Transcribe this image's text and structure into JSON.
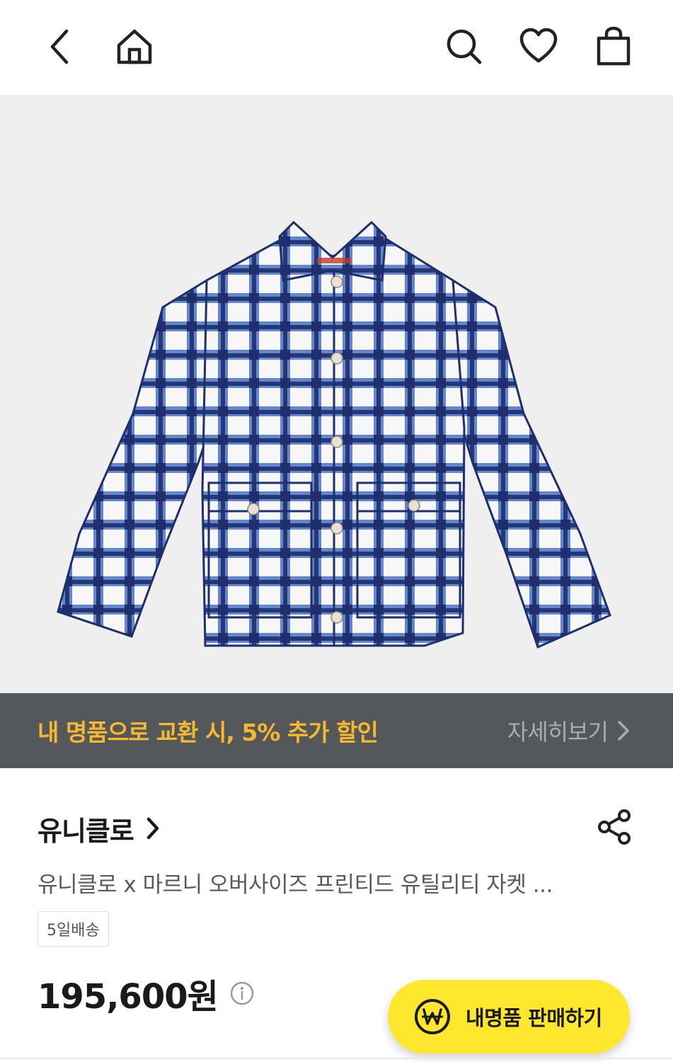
{
  "topbar": {
    "icons": [
      "back-icon",
      "home-icon",
      "search-icon",
      "heart-icon",
      "shopping-bag-icon"
    ]
  },
  "hero": {
    "image_subject": "product-photo",
    "colors": {
      "background": "#efeff0",
      "navy": "#1f2f6e",
      "blue": "#4a72c4",
      "white": "#f7f7f7"
    }
  },
  "promo": {
    "text": "내 명품으로 교환 시, 5% 추가 할인",
    "more_label": "자세히보기",
    "colors": {
      "background": "#54585b",
      "text": "#f5b82e",
      "more": "#a9adb0"
    }
  },
  "product": {
    "brand": "유니클로",
    "title": "유니클로 x 마르니 오버사이즈 프린티드 유틸리티 자켓 ...",
    "shipping_badge": "5일배송",
    "price": "195,600원"
  },
  "fab": {
    "label": "내명품 판매하기",
    "color": "#ffe72e"
  }
}
